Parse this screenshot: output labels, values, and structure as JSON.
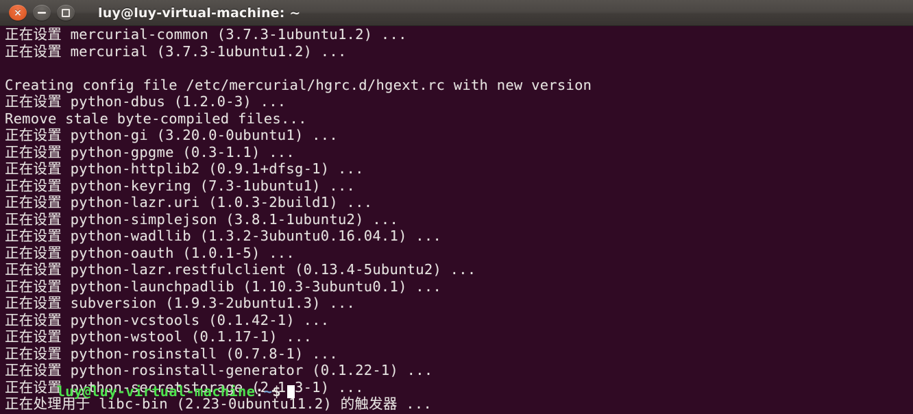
{
  "window": {
    "title": "luy@luy-virtual-machine: ~",
    "controls": {
      "close_label": "×",
      "close_name": "close",
      "minimize_name": "minimize",
      "maximize_name": "maximize"
    },
    "colors": {
      "terminal_background": "#300a24",
      "titlebar_background": "#4b4744",
      "text": "#e6e3e0",
      "prompt_user_host": "#4ee24e",
      "prompt_path": "#729fcf",
      "close_button": "#e4622f",
      "cursor": "#ffffff"
    }
  },
  "terminal": {
    "lines": [
      "正在设置 mercurial-common (3.7.3-1ubuntu1.2) ...",
      "正在设置 mercurial (3.7.3-1ubuntu1.2) ...",
      "",
      "Creating config file /etc/mercurial/hgrc.d/hgext.rc with new version",
      "正在设置 python-dbus (1.2.0-3) ...",
      "Remove stale byte-compiled files...",
      "正在设置 python-gi (3.20.0-0ubuntu1) ...",
      "正在设置 python-gpgme (0.3-1.1) ...",
      "正在设置 python-httplib2 (0.9.1+dfsg-1) ...",
      "正在设置 python-keyring (7.3-1ubuntu1) ...",
      "正在设置 python-lazr.uri (1.0.3-2build1) ...",
      "正在设置 python-simplejson (3.8.1-1ubuntu2) ...",
      "正在设置 python-wadllib (1.3.2-3ubuntu0.16.04.1) ...",
      "正在设置 python-oauth (1.0.1-5) ...",
      "正在设置 python-lazr.restfulclient (0.13.4-5ubuntu2) ...",
      "正在设置 python-launchpadlib (1.10.3-3ubuntu0.1) ...",
      "正在设置 subversion (1.9.3-2ubuntu1.3) ...",
      "正在设置 python-vcstools (0.1.42-1) ...",
      "正在设置 python-wstool (0.1.17-1) ...",
      "正在设置 python-rosinstall (0.7.8-1) ...",
      "正在设置 python-rosinstall-generator (0.1.22-1) ...",
      "正在设置 python-secretstorage (2.1.3-1) ...",
      "正在处理用于 libc-bin (2.23-0ubuntu11.2) 的触发器 ..."
    ],
    "prompt": {
      "user_host": "luy@luy-virtual-machine",
      "separator": ":",
      "path": "~",
      "symbol": "$"
    }
  }
}
